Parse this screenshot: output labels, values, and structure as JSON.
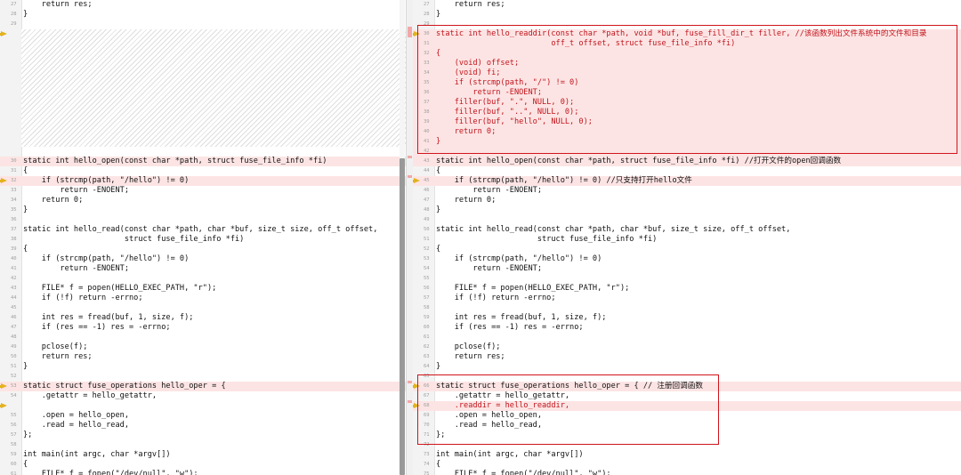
{
  "left": {
    "lines": [
      {
        "n": "27",
        "text": "    return res;",
        "hl": false
      },
      {
        "n": "28",
        "text": "}",
        "hl": false
      },
      {
        "n": "29",
        "text": "",
        "hl": false
      },
      {
        "placeholder": true,
        "arrow": true
      },
      {
        "n": "30",
        "text": "static int hello_open(const char *path, struct fuse_file_info *fi)",
        "hl": true
      },
      {
        "n": "31",
        "text": "{",
        "hl": false
      },
      {
        "n": "32",
        "text": "    if (strcmp(path, \"/hello\") != 0)",
        "hl": true,
        "arrow": true
      },
      {
        "n": "33",
        "text": "        return -ENOENT;",
        "hl": false
      },
      {
        "n": "34",
        "text": "    return 0;",
        "hl": false
      },
      {
        "n": "35",
        "text": "}",
        "hl": false
      },
      {
        "n": "36",
        "text": "",
        "hl": false
      },
      {
        "n": "37",
        "text": "static int hello_read(const char *path, char *buf, size_t size, off_t offset,",
        "hl": false
      },
      {
        "n": "38",
        "text": "                      struct fuse_file_info *fi)",
        "hl": false
      },
      {
        "n": "39",
        "text": "{",
        "hl": false
      },
      {
        "n": "40",
        "text": "    if (strcmp(path, \"/hello\") != 0)",
        "hl": false
      },
      {
        "n": "41",
        "text": "        return -ENOENT;",
        "hl": false
      },
      {
        "n": "42",
        "text": "",
        "hl": false
      },
      {
        "n": "43",
        "text": "    FILE* f = popen(HELLO_EXEC_PATH, \"r\");",
        "hl": false
      },
      {
        "n": "44",
        "text": "    if (!f) return -errno;",
        "hl": false
      },
      {
        "n": "45",
        "text": "",
        "hl": false
      },
      {
        "n": "46",
        "text": "    int res = fread(buf, 1, size, f);",
        "hl": false
      },
      {
        "n": "47",
        "text": "    if (res == -1) res = -errno;",
        "hl": false
      },
      {
        "n": "48",
        "text": "",
        "hl": false
      },
      {
        "n": "49",
        "text": "    pclose(f);",
        "hl": false
      },
      {
        "n": "50",
        "text": "    return res;",
        "hl": false
      },
      {
        "n": "51",
        "text": "}",
        "hl": false
      },
      {
        "n": "52",
        "text": "",
        "hl": false
      },
      {
        "n": "53",
        "text": "static struct fuse_operations hello_oper = {",
        "hl": true,
        "arrow": true
      },
      {
        "n": "54",
        "text": "    .getattr = hello_getattr,",
        "hl": false
      },
      {
        "placeholder": true,
        "arrow": true
      },
      {
        "n": "55",
        "text": "    .open = hello_open,",
        "hl": false
      },
      {
        "n": "56",
        "text": "    .read = hello_read,",
        "hl": false
      },
      {
        "n": "57",
        "text": "};",
        "hl": false
      },
      {
        "n": "58",
        "text": "",
        "hl": false
      },
      {
        "n": "59",
        "text": "int main(int argc, char *argv[])",
        "hl": false
      },
      {
        "n": "60",
        "text": "{",
        "hl": false
      },
      {
        "n": "61",
        "text": "    FILE* f = fopen(\"/dev/null\", \"w\");",
        "hl": false
      }
    ]
  },
  "right": {
    "lines": [
      {
        "n": "27",
        "text": "    return res;"
      },
      {
        "n": "28",
        "text": "}"
      },
      {
        "n": "29",
        "text": ""
      },
      {
        "n": "30",
        "text": "static int hello_readdir(const char *path, void *buf, fuse_fill_dir_t filler, //该函数列出文件系统中的文件和目录",
        "hl": true,
        "red": true,
        "arrow": true
      },
      {
        "n": "31",
        "text": "                         off_t offset, struct fuse_file_info *fi)",
        "hl": true,
        "red": true
      },
      {
        "n": "32",
        "text": "{",
        "hl": true,
        "red": true
      },
      {
        "n": "33",
        "text": "    (void) offset;",
        "hl": true,
        "red": true
      },
      {
        "n": "34",
        "text": "    (void) fi;",
        "hl": true,
        "red": true
      },
      {
        "n": "35",
        "text": "    if (strcmp(path, \"/\") != 0)",
        "hl": true,
        "red": true
      },
      {
        "n": "36",
        "text": "        return -ENOENT;",
        "hl": true,
        "red": true
      },
      {
        "n": "37",
        "text": "    filler(buf, \".\", NULL, 0);",
        "hl": true,
        "red": true
      },
      {
        "n": "38",
        "text": "    filler(buf, \"..\", NULL, 0);",
        "hl": true,
        "red": true
      },
      {
        "n": "39",
        "text": "    filler(buf, \"hello\", NULL, 0);",
        "hl": true,
        "red": true
      },
      {
        "n": "40",
        "text": "    return 0;",
        "hl": true,
        "red": true
      },
      {
        "n": "41",
        "text": "}",
        "hl": true,
        "red": true
      },
      {
        "n": "42",
        "text": "",
        "hl": true
      },
      {
        "n": "43",
        "text": "static int hello_open(const char *path, struct fuse_file_info *fi) //打开文件的open回调函数",
        "hl": true
      },
      {
        "n": "44",
        "text": "{"
      },
      {
        "n": "45",
        "text": "    if (strcmp(path, \"/hello\") != 0) //只支持打开hello文件",
        "hl": true,
        "arrow": true
      },
      {
        "n": "46",
        "text": "        return -ENOENT;"
      },
      {
        "n": "47",
        "text": "    return 0;"
      },
      {
        "n": "48",
        "text": "}"
      },
      {
        "n": "49",
        "text": ""
      },
      {
        "n": "50",
        "text": "static int hello_read(const char *path, char *buf, size_t size, off_t offset,"
      },
      {
        "n": "51",
        "text": "                      struct fuse_file_info *fi)"
      },
      {
        "n": "52",
        "text": "{"
      },
      {
        "n": "53",
        "text": "    if (strcmp(path, \"/hello\") != 0)"
      },
      {
        "n": "54",
        "text": "        return -ENOENT;"
      },
      {
        "n": "55",
        "text": ""
      },
      {
        "n": "56",
        "text": "    FILE* f = popen(HELLO_EXEC_PATH, \"r\");"
      },
      {
        "n": "57",
        "text": "    if (!f) return -errno;"
      },
      {
        "n": "58",
        "text": ""
      },
      {
        "n": "59",
        "text": "    int res = fread(buf, 1, size, f);"
      },
      {
        "n": "60",
        "text": "    if (res == -1) res = -errno;"
      },
      {
        "n": "61",
        "text": ""
      },
      {
        "n": "62",
        "text": "    pclose(f);"
      },
      {
        "n": "63",
        "text": "    return res;"
      },
      {
        "n": "64",
        "text": "}"
      },
      {
        "n": "65",
        "text": ""
      },
      {
        "n": "66",
        "text": "static struct fuse_operations hello_oper = { // 注册回调函数",
        "hl": true,
        "arrow": true
      },
      {
        "n": "67",
        "text": "    .getattr = hello_getattr,"
      },
      {
        "n": "68",
        "text": "    .readdir = hello_readdir,",
        "hl": true,
        "red": true,
        "arrow": true
      },
      {
        "n": "69",
        "text": "    .open = hello_open,"
      },
      {
        "n": "70",
        "text": "    .read = hello_read,"
      },
      {
        "n": "71",
        "text": "};"
      },
      {
        "n": "72",
        "text": ""
      },
      {
        "n": "73",
        "text": "int main(int argc, char *argv[])"
      },
      {
        "n": "74",
        "text": "{"
      },
      {
        "n": "75",
        "text": "    FILE* f = fopen(\"/dev/null\", \"w\");"
      }
    ]
  }
}
